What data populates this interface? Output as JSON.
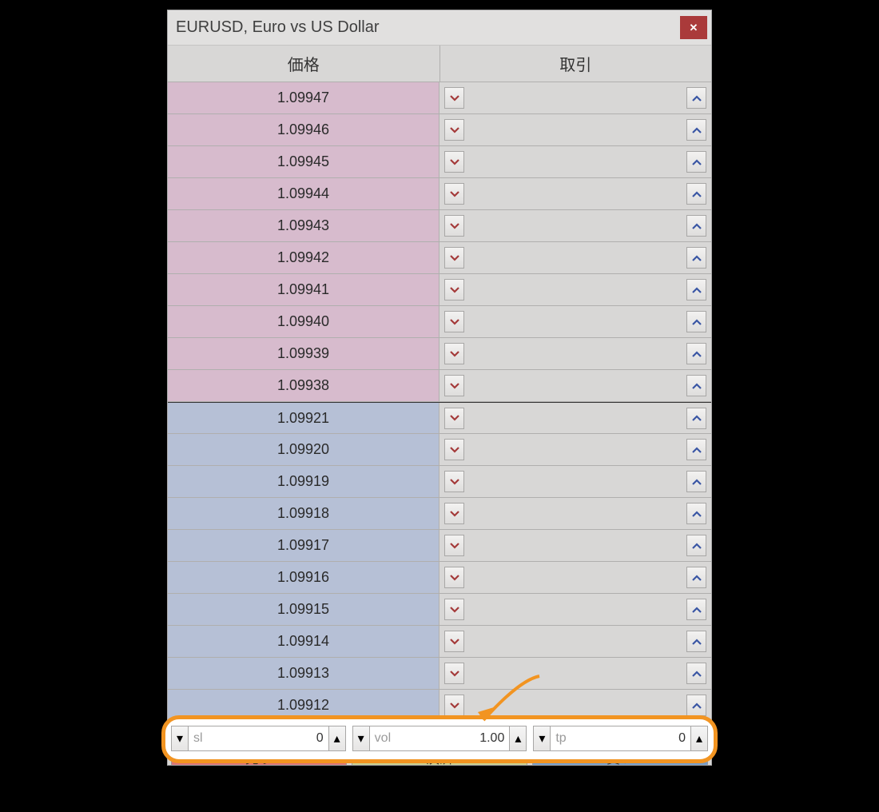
{
  "title": "EURUSD, Euro vs US Dollar",
  "headers": {
    "price": "価格",
    "trade": "取引"
  },
  "ask_rows": [
    "1.09947",
    "1.09946",
    "1.09945",
    "1.09944",
    "1.09943",
    "1.09942",
    "1.09941",
    "1.09940",
    "1.09939",
    "1.09938"
  ],
  "bid_rows": [
    "1.09921",
    "1.09920",
    "1.09919",
    "1.09918",
    "1.09917",
    "1.09916",
    "1.09915",
    "1.09914",
    "1.09913",
    "1.09912"
  ],
  "spinners": {
    "sl": {
      "label": "sl",
      "value": "0"
    },
    "vol": {
      "label": "vol",
      "value": "1.00"
    },
    "tp": {
      "label": "tp",
      "value": "0"
    }
  },
  "actions": {
    "sell": "売り",
    "close": "決済",
    "buy": "買い"
  }
}
